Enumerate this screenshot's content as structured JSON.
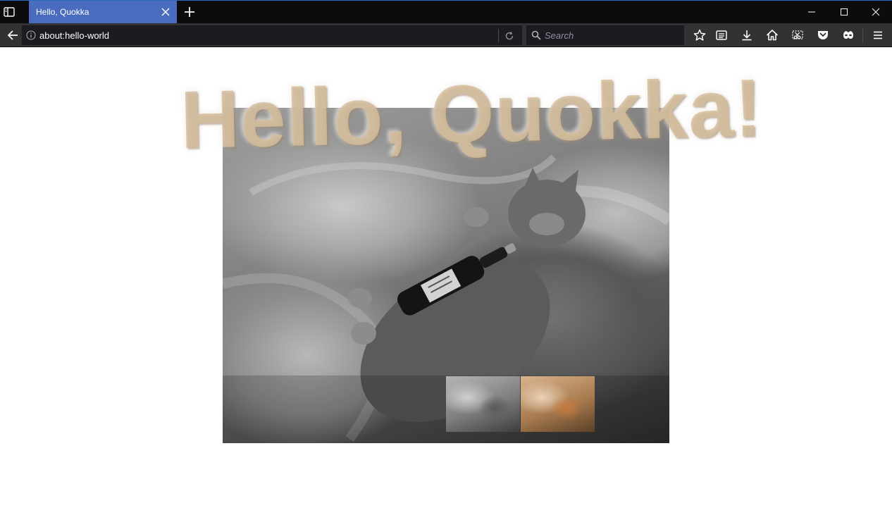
{
  "browser": {
    "tab": {
      "title": "Hello, Quokka"
    },
    "urlbar": {
      "value": "about:hello-world"
    },
    "searchbar": {
      "placeholder": "Search"
    },
    "accent_color": "#4a6cbf"
  },
  "icons": {
    "sidebar": "sidebar-icon",
    "close_tab": "close-icon",
    "new_tab": "plus-icon",
    "minimize": "minimize-icon",
    "maximize": "maximize-icon",
    "close_window": "close-window-icon",
    "back": "back-arrow-icon",
    "info": "info-icon",
    "reload": "reload-icon",
    "search": "search-icon",
    "bookmark": "star-icon",
    "reading_list": "reader-list-icon",
    "downloads": "download-icon",
    "home": "home-icon",
    "screenshot": "screenshot-icon",
    "pocket": "pocket-icon",
    "private": "mask-icon",
    "menu": "hamburger-menu-icon"
  },
  "page": {
    "headline": "Hello, Quokka!",
    "headline_color": "#d6be9e",
    "main_image": "grayscale photo of a cat sleeping on a bed hugging a bottle",
    "thumbnails": [
      {
        "name": "grayscale"
      },
      {
        "name": "warm"
      }
    ]
  }
}
